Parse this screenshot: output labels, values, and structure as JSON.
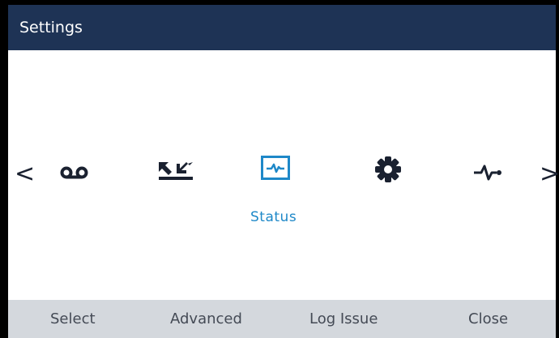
{
  "header": {
    "title": "Settings"
  },
  "carousel": {
    "items": [
      {
        "icon": "voicemail-icon"
      },
      {
        "icon": "call-logs-icon"
      },
      {
        "icon": "status-icon",
        "label": "Status",
        "selected": true
      },
      {
        "icon": "gear-icon"
      },
      {
        "icon": "diagnostics-icon"
      }
    ],
    "prev": "<",
    "next": ">"
  },
  "softkeys": {
    "select": "Select",
    "advanced": "Advanced",
    "log_issue": "Log Issue",
    "close": "Close"
  },
  "colors": {
    "title_bar": "#1e3355",
    "accent": "#1e88c8",
    "softkey_bar": "#d4d8dd"
  }
}
